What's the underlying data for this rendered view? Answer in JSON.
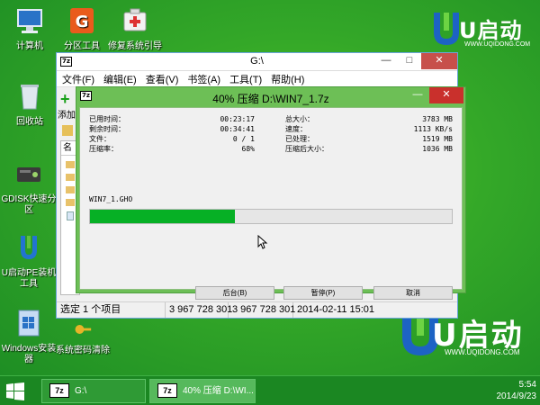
{
  "desktop": {
    "icons": [
      {
        "label": "计算机",
        "icon": "computer-icon"
      },
      {
        "label": "分区工具",
        "icon": "partition-tool-icon"
      },
      {
        "label": "修复系统引导",
        "icon": "repair-boot-icon"
      },
      {
        "label": "回收站",
        "icon": "recycle-bin-icon"
      },
      {
        "label": "GDISK快速分区",
        "icon": "gdisk-icon"
      },
      {
        "label": "U启动PE装机工具",
        "icon": "pe-installer-icon"
      },
      {
        "label": "Windows安装器",
        "icon": "windows-installer-icon"
      },
      {
        "label": "系统密码清除",
        "icon": "password-clear-icon"
      }
    ],
    "brand_logo_text": "U启动",
    "brand_url": "WWW.UQIDONG.COM",
    "accent_color": "#2e9e2a"
  },
  "explorer": {
    "title": "G:\\",
    "app_icon": "7z",
    "menu": [
      "文件(F)",
      "编辑(E)",
      "查看(V)",
      "书签(A)",
      "工具(T)",
      "帮助(H)"
    ],
    "toolbar_add_label": "添加",
    "column_name_label": "名称",
    "status": {
      "selected": "选定 1 个项目",
      "size": "3 967 728 301",
      "packed": "3 967 728 301",
      "modified": "2014-02-11 15:01"
    }
  },
  "dialog": {
    "title": "40% 压缩 D:\\WIN7_1.7z",
    "elapsed_label": "已用时间：",
    "elapsed_value": "00:23:17",
    "remaining_label": "剩余时间：",
    "remaining_value": "00:34:41",
    "files_label": "文件：",
    "files_value": "0 / 1",
    "ratio_label": "压缩率：",
    "ratio_value": "68%",
    "total_label": "总大小：",
    "total_value": "3783 MB",
    "speed_label": "速度：",
    "speed_value": "1113 KB/s",
    "processed_label": "已处理：",
    "processed_value": "1519 MB",
    "compressed_label": "压缩后大小：",
    "compressed_value": "1036 MB",
    "current_file": "WIN7_1.GHO",
    "progress_fraction": 0.4,
    "progress_color": "#06b025",
    "buttons": {
      "background": "后台(B)",
      "pause": "暂停(P)",
      "cancel": "取消"
    }
  },
  "taskbar": {
    "items": [
      {
        "label": "G:\\",
        "icon": "7z"
      },
      {
        "label": "40% 压缩 D:\\WI...",
        "icon": "7z"
      }
    ],
    "clock": {
      "time": "5:54",
      "date": "2014/9/23"
    }
  }
}
